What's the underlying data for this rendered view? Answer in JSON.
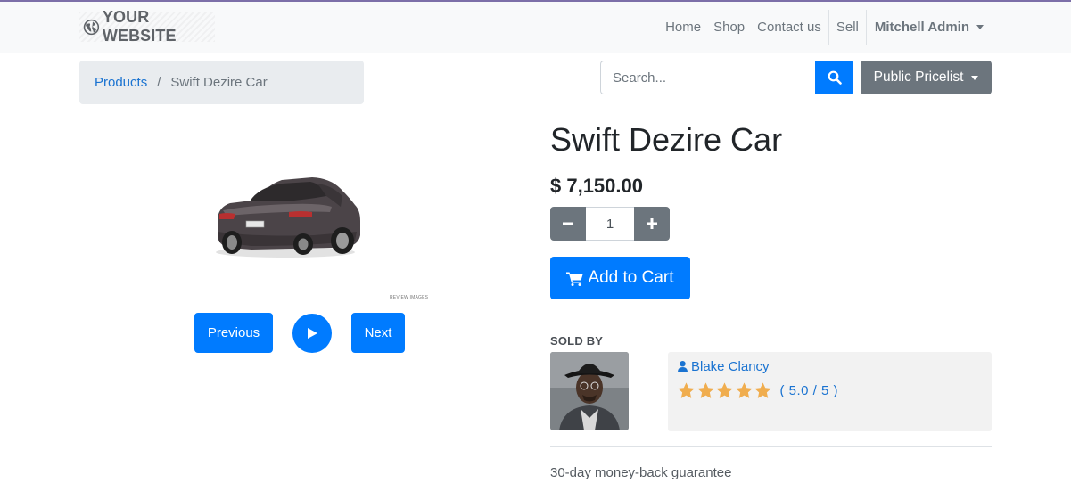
{
  "header": {
    "brand": "YOUR WEBSITE",
    "nav": [
      "Home",
      "Shop",
      "Contact us"
    ],
    "sell": "Sell",
    "user": "Mitchell Admin"
  },
  "breadcrumb": {
    "parent": "Products",
    "separator": "/",
    "current": "Swift Dezire Car"
  },
  "search": {
    "placeholder": "Search..."
  },
  "pricelist": {
    "label": "Public Pricelist"
  },
  "product": {
    "title": "Swift Dezire Car",
    "price": "$ 7,150.00",
    "quantity": "1",
    "add_to_cart": "Add to Cart",
    "image_credit": "REVIEW IMAGES"
  },
  "carousel": {
    "previous": "Previous",
    "next": "Next"
  },
  "seller": {
    "section_label": "SOLD BY",
    "name": "Blake Clancy",
    "rating_value": 5,
    "rating_max": 5,
    "rating_text": "( 5.0 / 5 )"
  },
  "info": {
    "guarantee": "30-day money-back guarantee"
  },
  "colors": {
    "primary": "#007bff",
    "secondary": "#6c757d",
    "link": "#1a73d1",
    "star": "#f0ad4e",
    "navbar_bg": "#f8f9fa"
  },
  "icons": {
    "brand": "globe-icon",
    "search": "search-icon",
    "cart": "shopping-cart-icon",
    "play": "play-icon",
    "minus": "minus-icon",
    "plus": "plus-icon",
    "user": "user-icon",
    "star": "star-icon"
  }
}
